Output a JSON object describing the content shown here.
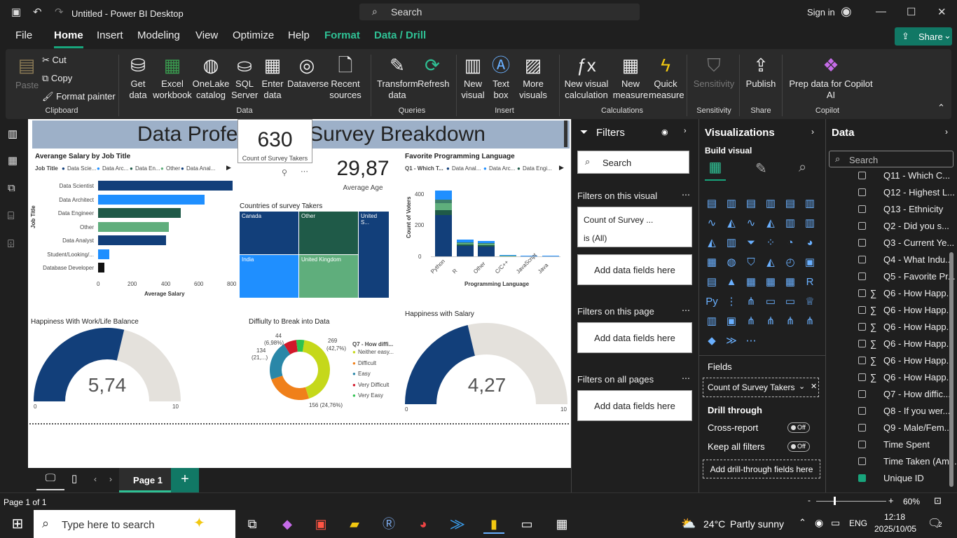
{
  "window": {
    "title": "Untitled - Power BI Desktop",
    "search": "Search",
    "sign_in": "Sign in"
  },
  "menu": {
    "items": [
      "File",
      "Home",
      "Insert",
      "Modeling",
      "View",
      "Optimize",
      "Help",
      "Format",
      "Data / Drill"
    ],
    "share": "Share"
  },
  "ribbon": {
    "clipboard": {
      "paste": "Paste",
      "cut": "Cut",
      "copy": "Copy",
      "format_painter": "Format painter",
      "group": "Clipboard"
    },
    "data_items": [
      {
        "l1": "Get",
        "l2": "data"
      },
      {
        "l1": "Excel",
        "l2": "workbook"
      },
      {
        "l1": "OneLake",
        "l2": "catalog"
      },
      {
        "l1": "SQL",
        "l2": "Server"
      },
      {
        "l1": "Enter",
        "l2": "data"
      },
      {
        "l1": "Dataverse",
        "l2": ""
      },
      {
        "l1": "Recent",
        "l2": "sources"
      }
    ],
    "data_group": "Data",
    "queries_items": [
      {
        "l1": "Transform",
        "l2": "data"
      },
      {
        "l1": "Refresh",
        "l2": ""
      }
    ],
    "queries_group": "Queries",
    "insert_items": [
      {
        "l1": "New",
        "l2": "visual"
      },
      {
        "l1": "Text",
        "l2": "box"
      },
      {
        "l1": "More",
        "l2": "visuals"
      }
    ],
    "insert_group": "Insert",
    "calc_items": [
      {
        "l1": "New visual",
        "l2": "calculation"
      },
      {
        "l1": "New",
        "l2": "measure"
      },
      {
        "l1": "Quick",
        "l2": "measure"
      }
    ],
    "calc_group": "Calculations",
    "sensitivity": {
      "label": "Sensitivity",
      "group": "Sensitivity"
    },
    "share": {
      "label": "Publish",
      "group": "Share"
    },
    "copilot": {
      "l1": "Prep data for Copilot",
      "l2": "AI",
      "group": "Copilot"
    }
  },
  "report": {
    "title": "Data Professional Survey Breakdown",
    "card_count": {
      "value": "630",
      "label": "Count of Survey Takers"
    },
    "card_age": {
      "value": "29,87",
      "label": "Average Age"
    },
    "salary_chart": {
      "title": "Averange Salary by Job Title",
      "legend_title": "Job Title",
      "legend": [
        "Data Scie...",
        "Data Arc...",
        "Data En...",
        "Other",
        "Data Anal..."
      ],
      "ylabel": "Job Title",
      "xlabel": "Average Salary",
      "ticks": [
        "0",
        "200",
        "400",
        "600",
        "800"
      ]
    },
    "treemap": {
      "title": "Countries of survey Takers",
      "cells": [
        "Canada",
        "Other",
        "United S...",
        "India",
        "United Kingdom"
      ]
    },
    "lang_chart": {
      "title": "Favorite Programming Language",
      "legend_title": "Q1 - Which T...",
      "legend": [
        "Data Anal...",
        "Data Arc...",
        "Data Engi..."
      ],
      "ylabel": "Count of Voters",
      "xlabel": "Programming Language",
      "yticks": [
        "400",
        "200",
        "0"
      ]
    },
    "gauge1": {
      "title": "Happiness With Work/Life Balance",
      "value": "5,74",
      "min": "0",
      "max": "10"
    },
    "donut": {
      "title": "Diffiulty to Break into Data",
      "legend_title": "Q7 - How diffi...",
      "legend": [
        "Neither easy...",
        "Difficult",
        "Easy",
        "Very Difficult",
        "Very Easy"
      ],
      "labels": [
        "269",
        "(42,7%)",
        "156 (24,76%)",
        "134",
        "(21,...)",
        "44",
        "(6,98%)"
      ]
    },
    "gauge2": {
      "title": "Happiness with Salary",
      "value": "4,27",
      "min": "0",
      "max": "10"
    }
  },
  "chart_data": [
    {
      "type": "bar",
      "title": "Averange Salary by Job Title",
      "categories": [
        "Data Scientist",
        "Data Architect",
        "Data Engineer",
        "Other",
        "Data Analyst",
        "Student/Looking/...",
        "Database Developer"
      ],
      "values": [
        730,
        580,
        450,
        385,
        370,
        60,
        35
      ],
      "xlabel": "Average Salary",
      "ylabel": "Job Title",
      "xlim": [
        0,
        800
      ]
    },
    {
      "type": "bar",
      "title": "Favorite Programming Language",
      "categories": [
        "Python",
        "R",
        "Other",
        "C/C++",
        "JavaScript",
        "Java"
      ],
      "values": [
        420,
        105,
        100,
        8,
        6,
        3
      ],
      "xlabel": "Programming Language",
      "ylabel": "Count of Voters",
      "ylim": [
        0,
        450
      ]
    },
    {
      "type": "pie",
      "title": "Diffiulty to Break into Data",
      "categories": [
        "Neither easy...",
        "Difficult",
        "Easy",
        "Very Difficult",
        "Very Easy"
      ],
      "values": [
        269,
        156,
        134,
        44,
        27
      ]
    }
  ],
  "filters": {
    "title": "Filters",
    "search": "Search",
    "on_visual": "Filters on this visual",
    "field": "Count of Survey ...",
    "field_state": "is (All)",
    "add": "Add data fields here",
    "on_page": "Filters on this page",
    "on_all": "Filters on all pages"
  },
  "viz": {
    "title": "Visualizations",
    "build": "Build visual",
    "fields": "Fields",
    "field_value": "Count of Survey Takers",
    "drill": "Drill through",
    "cross": "Cross-report",
    "cross_state": "Off",
    "keep": "Keep all filters",
    "keep_state": "Off",
    "add_drill": "Add drill-through fields here"
  },
  "data_pane": {
    "title": "Data",
    "search": "Search",
    "fields": [
      "Q11 - Which C...",
      "Q12 - Highest L...",
      "Q13 - Ethnicity",
      "Q2 - Did you s...",
      "Q3 - Current Ye...",
      "Q4 - What Indu...",
      "Q5 - Favorite Pr...",
      "Q6 - How Happ...",
      "Q6 - How Happ...",
      "Q6 - How Happ...",
      "Q6 - How Happ...",
      "Q6 - How Happ...",
      "Q6 - How Happ...",
      "Q7 - How diffic...",
      "Q8 - If you wer...",
      "Q9 - Male/Fem...",
      "Time Spent",
      "Time Taken (Am...",
      "Unique ID"
    ]
  },
  "pagebar": {
    "page": "Page 1"
  },
  "status": {
    "page": "Page 1 of 1",
    "zoom": "60%"
  },
  "taskbar": {
    "search": "Type here to search",
    "weather": "24°C",
    "weather_desc": "Partly sunny",
    "lang": "ENG",
    "time": "12:18",
    "date": "2025/10/05",
    "notif": "2"
  }
}
